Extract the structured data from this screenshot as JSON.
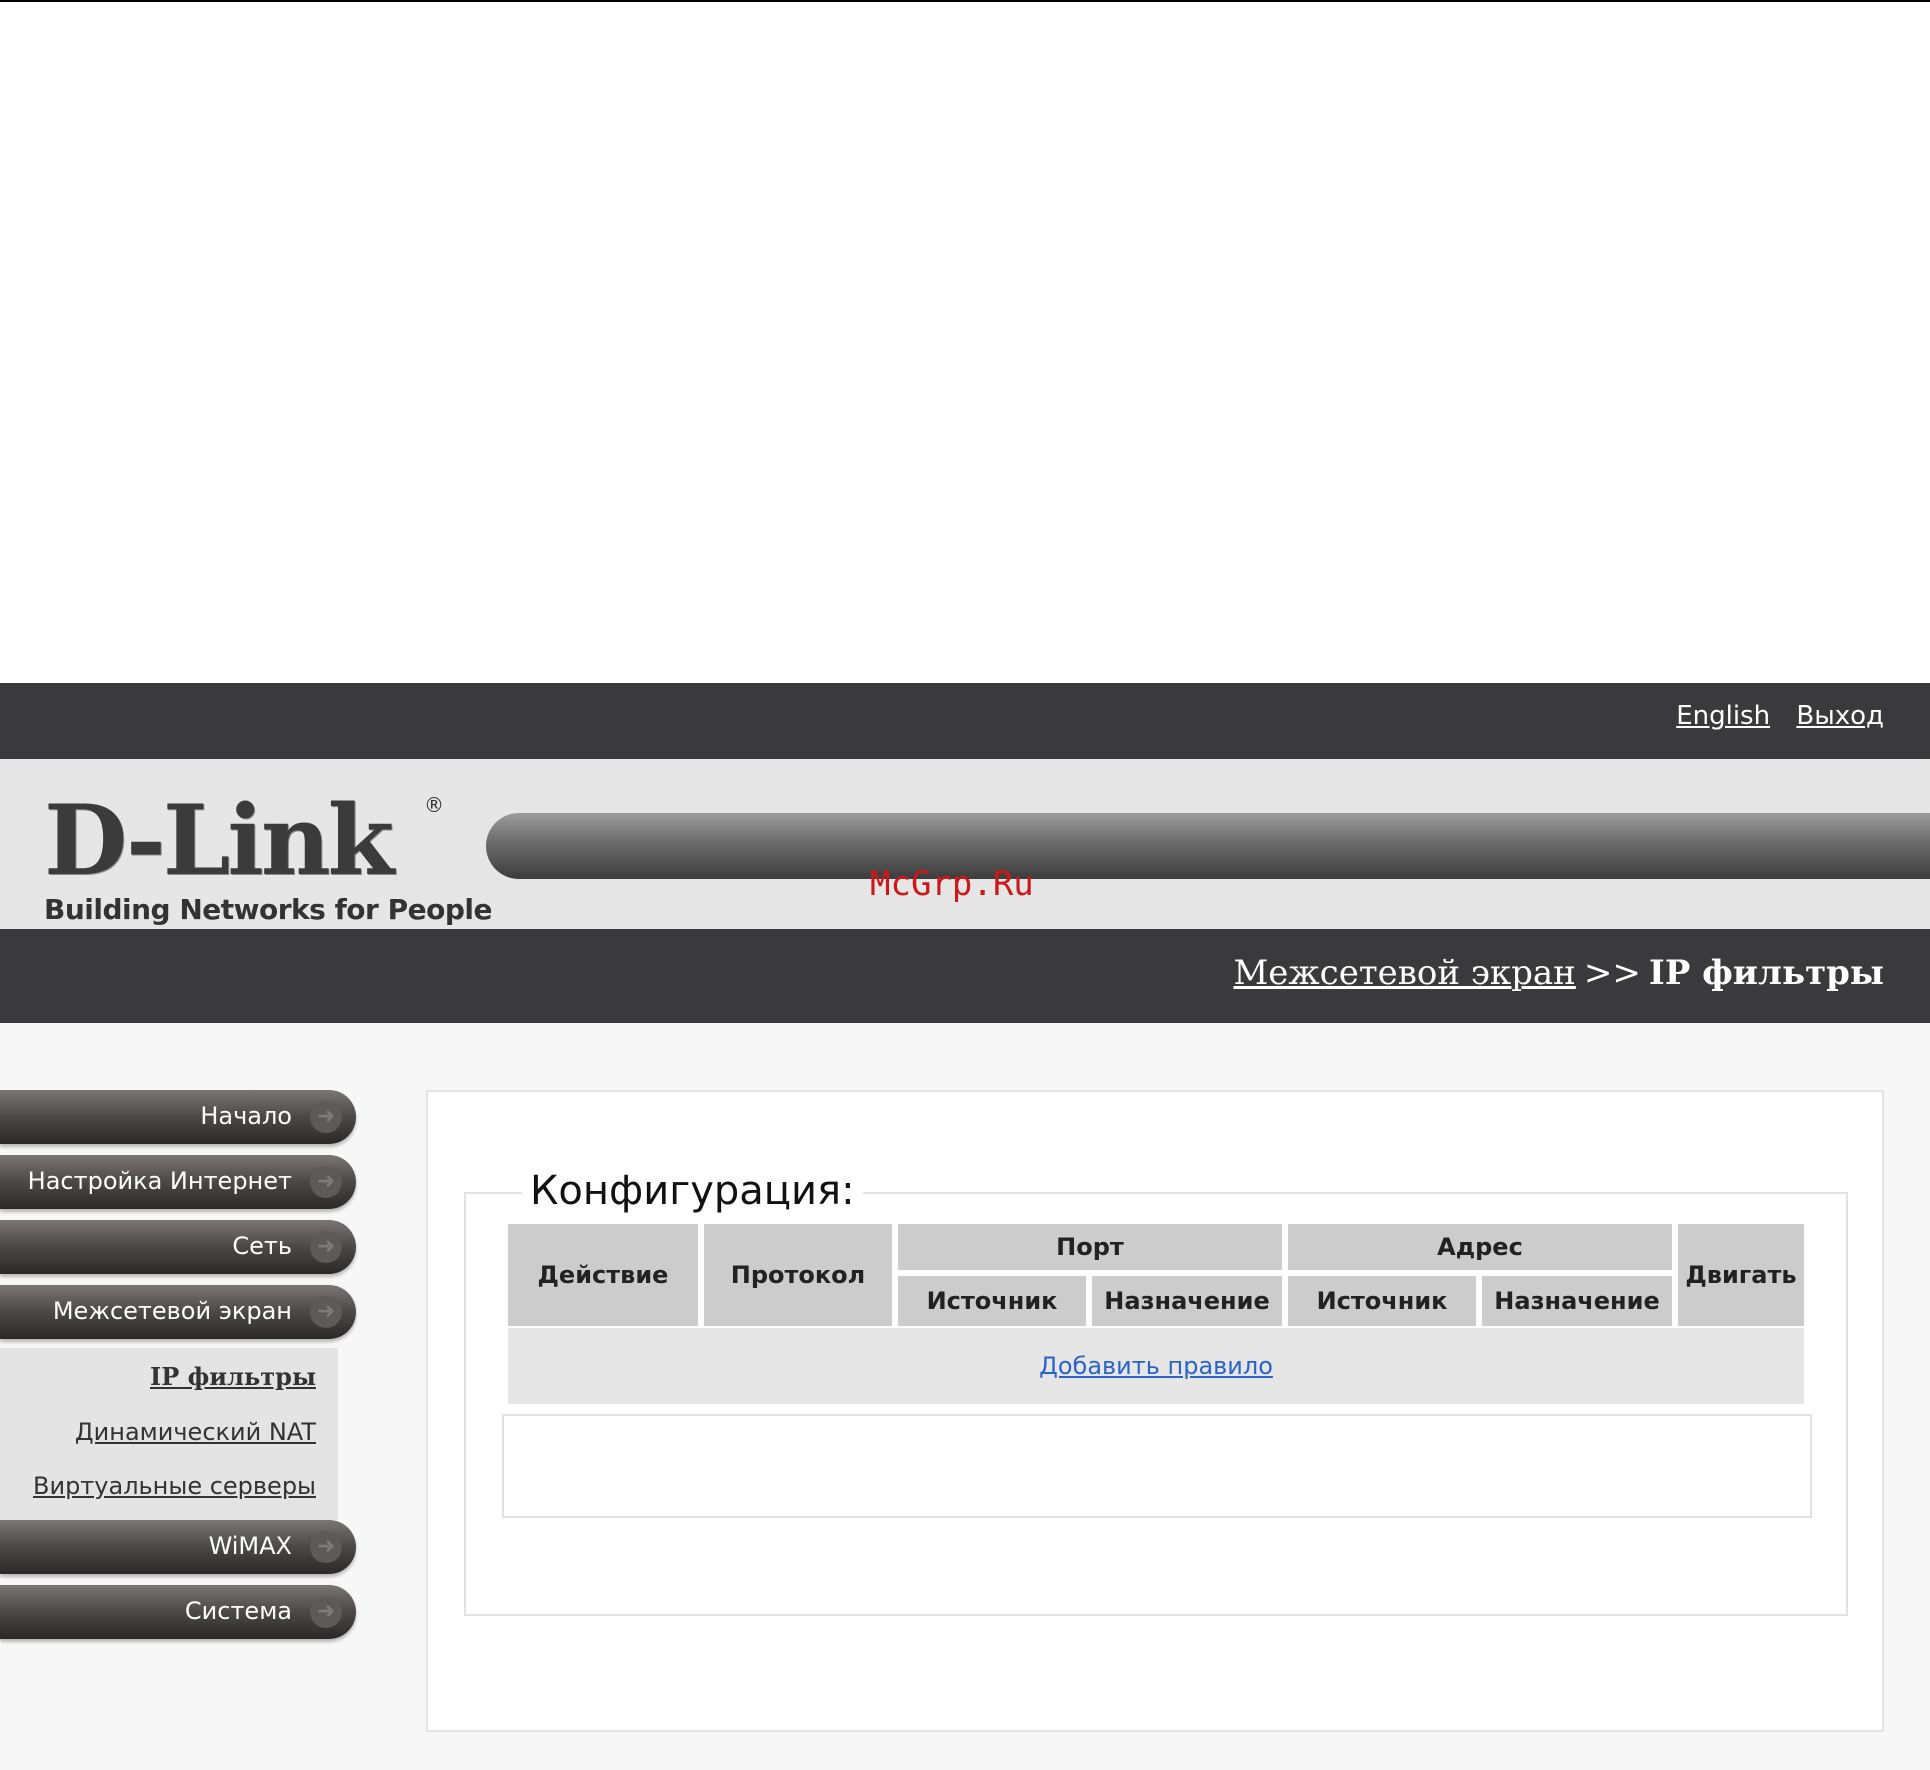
{
  "header": {
    "links": [
      "English",
      "Выход"
    ]
  },
  "logo": {
    "brand": "D-Link",
    "registered": "®",
    "tagline": "Building Networks for People"
  },
  "watermark": "McGrp.Ru",
  "breadcrumb": {
    "parent": "Межсетевой экран",
    "separator": ">>",
    "current": "IP фильтры"
  },
  "menu": {
    "items": [
      "Начало",
      "Настройка Интернет",
      "Сеть",
      "Межсетевой экран",
      "WiMAX",
      "Система"
    ],
    "submenu": [
      "IP фильтры",
      "Динамический NAT",
      "Виртуальные серверы"
    ],
    "active_submenu": "IP фильтры"
  },
  "config": {
    "title": "Конфигурация:",
    "columns": {
      "action": "Действие",
      "protocol": "Протокол",
      "port": "Порт",
      "address": "Адрес",
      "source": "Источник",
      "destination": "Назначение",
      "move": "Двигать"
    },
    "add_rule": "Добавить правило"
  }
}
